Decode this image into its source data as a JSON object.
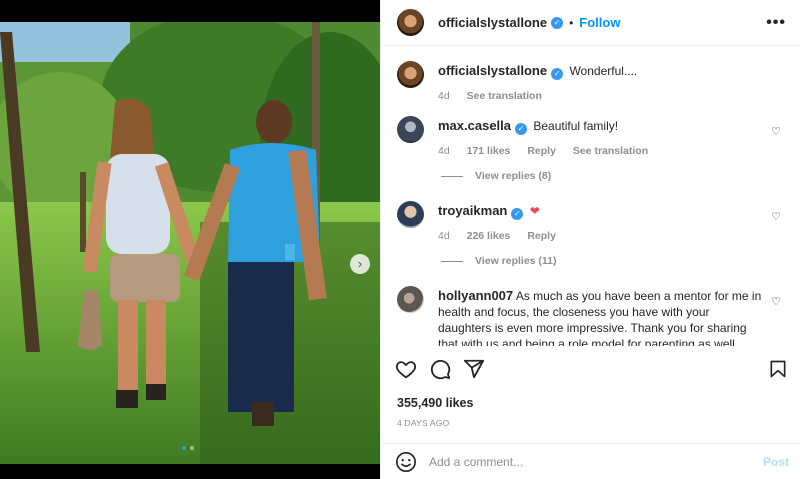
{
  "post": {
    "author": "officialslystallone",
    "follow_label": "Follow",
    "more_label": "•••",
    "caption": "Wonderful....",
    "caption_time": "4d",
    "caption_translate": "See translation",
    "likes": "355,490 likes",
    "posted_ago": "4 DAYS AGO"
  },
  "comments": [
    {
      "user": "max.casella",
      "text": "Beautiful family!",
      "time": "4d",
      "likes": "171 likes",
      "reply": "Reply",
      "translate": "See translation",
      "view_replies": "View replies (8)"
    },
    {
      "user": "troyaikman",
      "text": "",
      "emoji": "❤",
      "time": "4d",
      "likes": "226 likes",
      "reply": "Reply",
      "view_replies": "View replies (11)"
    },
    {
      "user": "hollyann007",
      "text": "As much as you have been a mentor for me in health and focus, the closeness you have with your daughters is even more impressive. Thank you for sharing that with us and being a role model for parenting as well."
    }
  ],
  "composer": {
    "placeholder": "Add a comment...",
    "post_label": "Post"
  },
  "icons": [
    "heart-icon",
    "comment-icon",
    "share-icon",
    "bookmark-icon",
    "emoji-icon",
    "verified-icon",
    "chevron-right-icon"
  ],
  "colors": {
    "accent": "#0095f6",
    "verified": "#3897f0",
    "like_red": "#ed4956"
  }
}
